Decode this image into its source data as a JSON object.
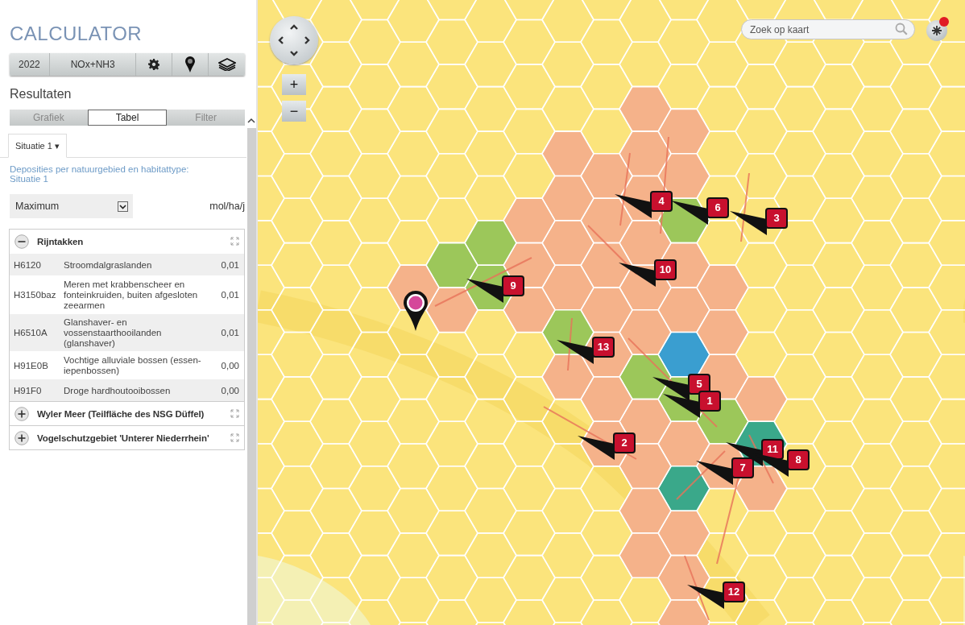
{
  "app": {
    "title": "CALCULATOR"
  },
  "toolbar": [
    {
      "kind": "text",
      "label": "2022"
    },
    {
      "kind": "text",
      "label": "NOx+NH3"
    },
    {
      "kind": "settings"
    },
    {
      "kind": "location"
    },
    {
      "kind": "layers"
    }
  ],
  "results": {
    "heading": "Resultaten",
    "tabs": [
      {
        "label": "Grafiek",
        "selected": false
      },
      {
        "label": "Tabel",
        "selected": true
      },
      {
        "label": "Filter",
        "selected": false
      }
    ],
    "situation_tab": {
      "label": "Situatie 1 ▾"
    },
    "description_lines": [
      "Deposities per natuurgebied en habitattype:",
      "Situatie 1"
    ],
    "select": {
      "value": "Maximum"
    },
    "unit": "mol/ha/j",
    "areas": [
      {
        "name": "Rijntakken",
        "expanded": true,
        "habitats": [
          {
            "code": "H6120",
            "name": "Stroomdalgraslanden",
            "value": "0,01"
          },
          {
            "code": "H3150baz",
            "name": "Meren met krabbenscheer en fonteinkruiden, buiten afgesloten zeearmen",
            "value": "0,01"
          },
          {
            "code": "H6510A",
            "name": "Glanshaver- en vossenstaarthooilanden (glanshaver)",
            "value": "0,01"
          },
          {
            "code": "H91E0B",
            "name": "Vochtige alluviale bossen (essen-iepenbossen)",
            "value": "0,00"
          },
          {
            "code": "H91F0",
            "name": "Droge hardhoutooibossen",
            "value": "0,00"
          }
        ]
      },
      {
        "name": "Wyler Meer (Teilfläche des NSG Düffel)",
        "expanded": false
      },
      {
        "name": "Vogelschutzgebiet 'Unterer Niederrhein'",
        "expanded": false
      }
    ]
  },
  "map": {
    "search": {
      "placeholder": "Zoek op kaart"
    },
    "zoom_in": "+",
    "zoom_out": "−",
    "markers": [
      "4",
      "6",
      "3",
      "10",
      "9",
      "13",
      "5",
      "1",
      "2",
      "11",
      "8",
      "7",
      "12"
    ]
  }
}
